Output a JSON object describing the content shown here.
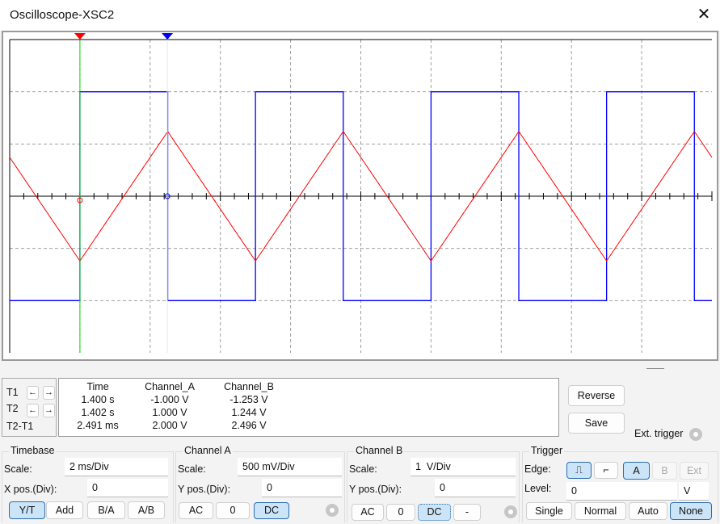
{
  "window": {
    "title": "Oscilloscope-XSC2",
    "close_icon": "close-icon"
  },
  "colors": {
    "channel_a": "#ff0000",
    "channel_b": "#0000ff",
    "cursor_line": "#00dd00",
    "grid": "#a0a0a0"
  },
  "chart_data": {
    "type": "line",
    "grid": true,
    "divisions": {
      "x": 10,
      "y": 6
    },
    "xlim_ms": [
      0,
      20
    ],
    "series": [
      {
        "name": "Channel_A",
        "shape": "triangle",
        "period_ms": 5,
        "min_time_ms": 2.0,
        "amplitude_div": 1.24,
        "scale": "500 mV/Div"
      },
      {
        "name": "Channel_B",
        "shape": "square",
        "period_ms": 5,
        "rise_time_ms": 2.0,
        "fall_time_ms": 4.5,
        "amplitude_div": 2.0,
        "scale": "1  V/Div"
      }
    ],
    "cursors": [
      {
        "label": "1",
        "time_ms": 2.0
      },
      {
        "label": "2",
        "time_ms": 4.49
      }
    ]
  },
  "cursors": {
    "t1": "T1",
    "t2": "T2",
    "diff": "T2-T1"
  },
  "readout": {
    "headers": [
      "Time",
      "Channel_A",
      "Channel_B"
    ],
    "rows": [
      [
        "1.400 s",
        "-1.000 V",
        "-1.253 V"
      ],
      [
        "1.402 s",
        "1.000 V",
        "1.244 V"
      ],
      [
        "2.491 ms",
        "2.000 V",
        "2.496 V"
      ]
    ]
  },
  "buttons": {
    "reverse": "Reverse",
    "save": "Save",
    "ext_trigger": "Ext. trigger"
  },
  "timebase": {
    "title": "Timebase",
    "scale_label": "Scale:",
    "scale": "2 ms/Div",
    "xpos_label": "X pos.(Div):",
    "xpos": "0",
    "modes": [
      "Y/T",
      "Add",
      "B/A",
      "A/B"
    ],
    "active": "Y/T"
  },
  "channel_a": {
    "title": "Channel A",
    "scale_label": "Scale:",
    "scale": "500 mV/Div",
    "ypos_label": "Y pos.(Div):",
    "ypos": "0",
    "coupling": [
      "AC",
      "0",
      "DC"
    ],
    "active": "DC"
  },
  "channel_b": {
    "title": "Channel B",
    "scale_label": "Scale:",
    "scale": "1  V/Div",
    "ypos_label": "Y pos.(Div):",
    "ypos": "0",
    "coupling": [
      "AC",
      "0",
      "DC",
      "-"
    ],
    "active": "DC"
  },
  "trigger": {
    "title": "Trigger",
    "edge_label": "Edge:",
    "edges": [
      "rising-edge-icon",
      "falling-edge-icon"
    ],
    "sources": [
      "A",
      "B",
      "Ext"
    ],
    "active_source": "A",
    "level_label": "Level:",
    "level": "0",
    "level_unit": "V",
    "modes": [
      "Single",
      "Normal",
      "Auto",
      "None"
    ],
    "active_mode": "None"
  }
}
